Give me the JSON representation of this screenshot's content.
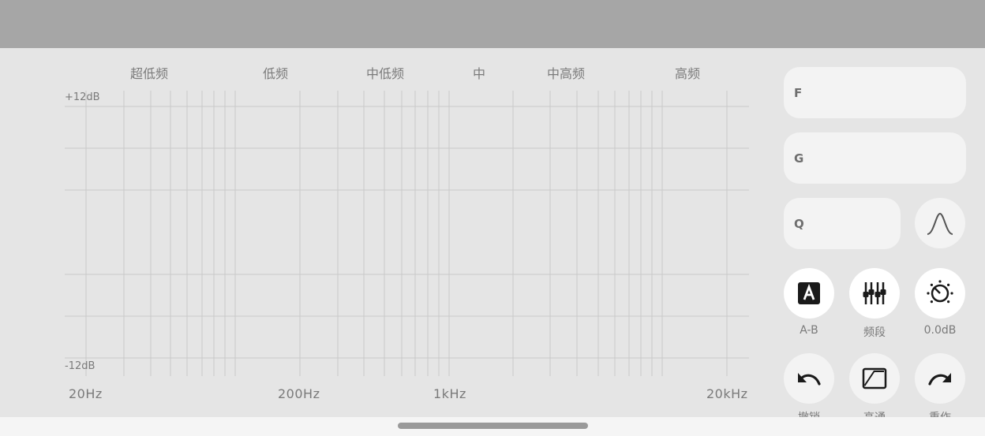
{
  "bands": [
    "超低频",
    "低频",
    "中低频",
    "中",
    "中高频",
    "高频"
  ],
  "db_axis": {
    "top": "+12dB",
    "bottom": "-12dB"
  },
  "freq_axis": [
    "20Hz",
    "200Hz",
    "1kHz",
    "20kHz"
  ],
  "eq_curve": {
    "gain_db": 0,
    "color": "#2f9bd6"
  },
  "fields": {
    "f_label": "F",
    "g_label": "G",
    "q_label": "Q"
  },
  "buttons": {
    "ab": {
      "label": "A-B",
      "icon": "a-letter-icon"
    },
    "bands": {
      "label": "频段",
      "icon": "sliders-icon"
    },
    "gain": {
      "label": "0.0dB",
      "icon": "knob-icon"
    },
    "undo": {
      "label": "撤销",
      "icon": "undo-icon"
    },
    "pass": {
      "label": "高通",
      "icon": "high-pass-icon"
    },
    "redo": {
      "label": "重作",
      "icon": "redo-icon"
    },
    "filter_shape": {
      "icon": "peak-filter-icon"
    }
  }
}
